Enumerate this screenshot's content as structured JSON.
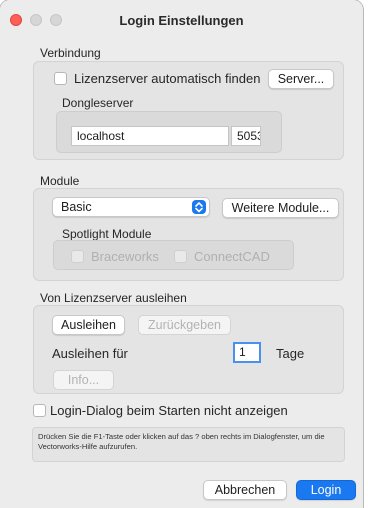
{
  "window": {
    "title": "Login Einstellungen"
  },
  "connection": {
    "section_label": "Verbindung",
    "auto_find_label": "Lizenzserver automatisch finden",
    "server_button": "Server...",
    "dongle_label": "Dongleserver",
    "host_value": "localhost",
    "port_value": "5053"
  },
  "modules": {
    "section_label": "Module",
    "selected_module": "Basic",
    "more_button": "Weitere Module...",
    "spotlight_label": "Spotlight Module",
    "braceworks_label": "Braceworks",
    "connectcad_label": "ConnectCAD"
  },
  "borrow": {
    "section_label": "Von Lizenzserver ausleihen",
    "borrow_button": "Ausleihen",
    "return_button": "Zurückgeben",
    "borrow_for_label": "Ausleihen für",
    "days_value": "1",
    "days_unit": "Tage",
    "info_button": "Info..."
  },
  "startup": {
    "hide_dialog_label": "Login-Dialog beim Starten nicht anzeigen"
  },
  "help": {
    "text": "Drücken Sie die F1-Taste oder klicken auf das ? oben rechts im Dialogfenster, um die Vectorworks-Hilfe aufzurufen."
  },
  "footer": {
    "cancel_button": "Abbrechen",
    "login_button": "Login"
  },
  "colors": {
    "accent": "#1a78f0",
    "close": "#ff5f57"
  },
  "icons": {
    "popup_arrows": "up-down-chevron-icon"
  }
}
